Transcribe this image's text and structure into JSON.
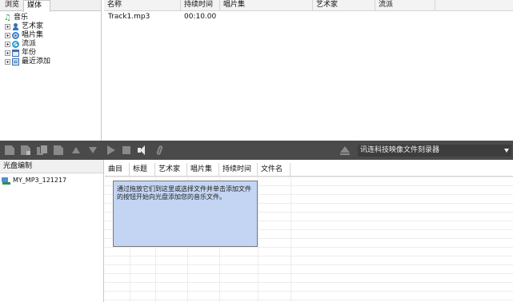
{
  "left_panel": {
    "tabs": [
      {
        "label": "浏览"
      },
      {
        "label": "媒体"
      }
    ],
    "tree": {
      "root": {
        "label": "音乐",
        "icon": "music-note-icon"
      },
      "children": [
        {
          "label": "艺术家",
          "icon": "artist-icon"
        },
        {
          "label": "唱片集",
          "icon": "album-icon"
        },
        {
          "label": "流派",
          "icon": "genre-icon"
        },
        {
          "label": "年份",
          "icon": "calendar-icon"
        },
        {
          "label": "最近添加",
          "icon": "recent-icon"
        }
      ]
    }
  },
  "track_list": {
    "columns": [
      "名称",
      "持续时间",
      "唱片集",
      "艺术家",
      "流派"
    ],
    "rows": [
      {
        "name": "Track1.mp3",
        "duration": "00:10.00",
        "album": "",
        "artist": "",
        "genre": ""
      }
    ]
  },
  "toolbar": {
    "buttons": [
      "add-file-icon",
      "add-folder-icon",
      "copy-icon",
      "remove-icon",
      "move-up-icon",
      "move-down-icon",
      "play-icon",
      "stop-icon",
      "volume-icon",
      "attach-icon"
    ],
    "eject_icon": "eject-icon",
    "drive": {
      "selected": "讯连科技映像文件刻录器"
    }
  },
  "disc_panel": {
    "title": "光盘编制",
    "item": "MY_MP3_121217"
  },
  "disc_contents": {
    "columns": [
      "曲目",
      "标题",
      "艺术家",
      "唱片集",
      "持续时间",
      "文件名"
    ],
    "hint": "通过拖放它们到这里或选择文件并单击添加文件的按钮开始向光盘添加您的音乐文件。"
  },
  "colors": {
    "toolbar_bg": "#4a4a4a",
    "hint_bg": "#c3d5f2"
  }
}
